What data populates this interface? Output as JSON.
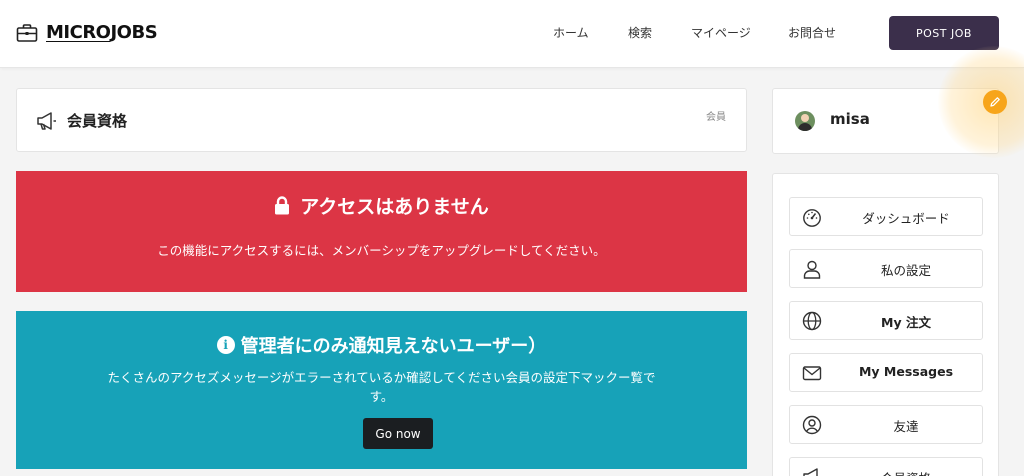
{
  "header": {
    "logo_part1": "MICRO",
    "logo_part2": "JOBS",
    "nav": [
      "ホーム",
      "検索",
      "マイページ",
      "お問合せ"
    ],
    "post_job_label": "POST JOB"
  },
  "title_panel": {
    "title": "会員資格",
    "breadcrumb": "会員"
  },
  "alert_red": {
    "title": "アクセスはありません",
    "message": "この機能にアクセスするには、メンバーシップをアップグレードしてください。",
    "color": "#dc3545"
  },
  "alert_teal": {
    "title": "管理者にのみ通知見えないユーザー）",
    "message": "たくさんのアクセズメッセージがエラーされているか確認してください会員の設定下マックー覧です。",
    "button_label": "Go now",
    "color": "#17a2b8"
  },
  "user": {
    "name": "misa"
  },
  "menu": [
    {
      "label": "ダッシュボード",
      "icon": "dashboard-icon"
    },
    {
      "label": "私の設定",
      "icon": "user-icon"
    },
    {
      "label": "My 注文",
      "icon": "globe-icon"
    },
    {
      "label": "My Messages",
      "icon": "envelope-icon"
    },
    {
      "label": "友達",
      "icon": "user-circle-icon"
    },
    {
      "label": "会員資格",
      "icon": "megaphone-icon"
    }
  ],
  "colors": {
    "accent": "#3b2f4b",
    "edit_button": "#f7a51b"
  }
}
